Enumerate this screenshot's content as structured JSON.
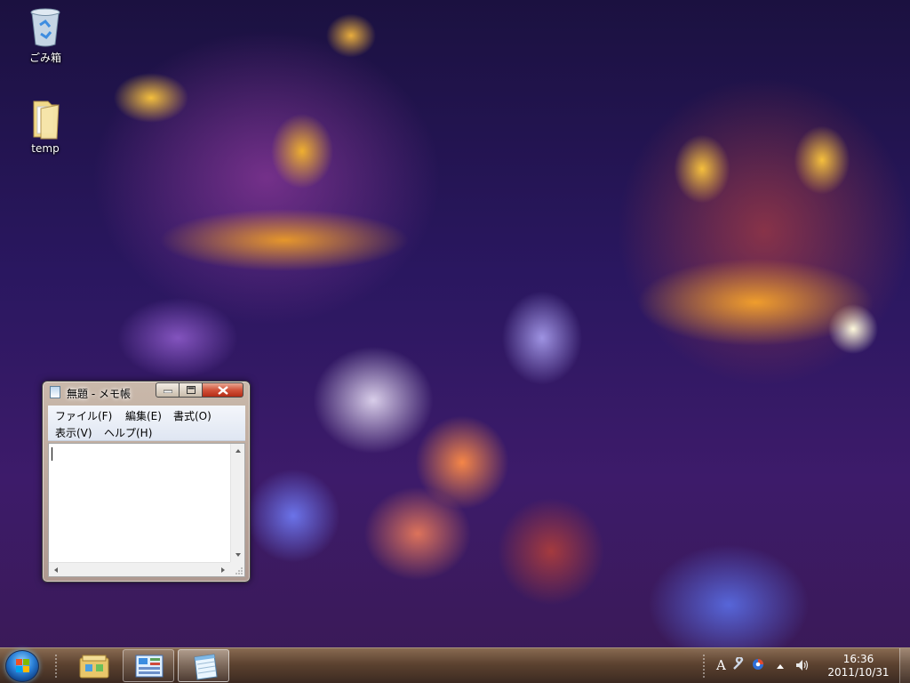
{
  "desktop": {
    "icons": [
      {
        "label": "ごみ箱",
        "icon": "recycle-bin-icon"
      },
      {
        "label": "temp",
        "icon": "folder-icon"
      }
    ]
  },
  "notepad": {
    "title": "無題 - メモ帳",
    "menu": [
      "ファイル(F)",
      "編集(E)",
      "書式(O)",
      "表示(V)",
      "ヘルプ(H)"
    ],
    "text_content": ""
  },
  "taskbar": {
    "start_icon": "windows-start-orb-icon",
    "pinned": [
      {
        "icon": "windows-explorer-icon",
        "state": "pinned"
      },
      {
        "icon": "control-panel-icon",
        "state": "open"
      },
      {
        "icon": "notepad-icon",
        "state": "active"
      }
    ],
    "tray": {
      "ime": "A",
      "icons": [
        "ime-tools-icon",
        "ime-status-icon",
        "show-hidden-icons-icon",
        "volume-icon"
      ]
    },
    "clock": {
      "time": "16:36",
      "date": "2011/10/31"
    }
  }
}
